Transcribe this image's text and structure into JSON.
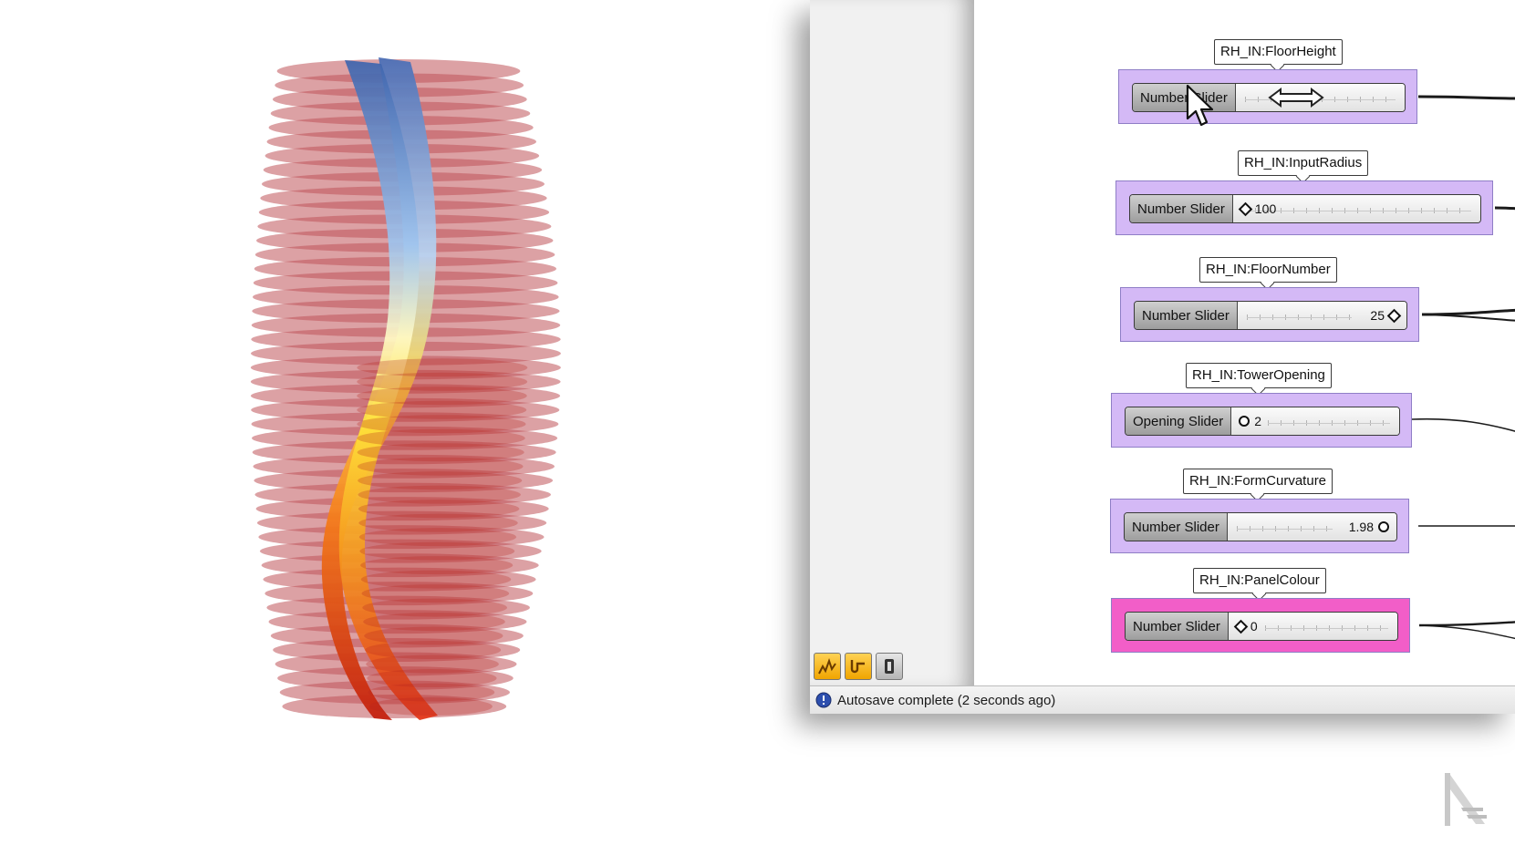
{
  "sliders": [
    {
      "tag": "RH_IN:FloorHeight",
      "label": "Number Slider",
      "value": "",
      "grip": "none",
      "group_color": "#d4b9f6"
    },
    {
      "tag": "RH_IN:InputRadius",
      "label": "Number Slider",
      "value": "100",
      "grip": "diamond-left",
      "group_color": "#d4b9f6"
    },
    {
      "tag": "RH_IN:FloorNumber",
      "label": "Number Slider",
      "value": "25",
      "grip": "diamond-right",
      "group_color": "#d4b9f6"
    },
    {
      "tag": "RH_IN:TowerOpening",
      "label": "Opening Slider",
      "value": "2",
      "grip": "circle-left",
      "group_color": "#d4b9f6"
    },
    {
      "tag": "RH_IN:FormCurvature",
      "label": "Number Slider",
      "value": "1.98",
      "grip": "circle-right",
      "group_color": "#d4b9f6"
    },
    {
      "tag": "RH_IN:PanelColour",
      "label": "Number Slider",
      "value": "0",
      "grip": "diamond-left",
      "group_color": "#f25ec8"
    }
  ],
  "status": {
    "text": "Autosave complete (2 seconds ago)",
    "icon": "info-icon"
  },
  "toolbar": {
    "icons": [
      "graph-icon",
      "wrench-icon",
      "device-icon"
    ]
  },
  "colors": {
    "accent_group": "#d4b9f6",
    "highlight_group": "#f25ec8",
    "tower_red": "#c0545a",
    "tower_blue": "#5b86c9",
    "tower_yellow": "#ffe24a",
    "tower_orange": "#e8421c"
  }
}
